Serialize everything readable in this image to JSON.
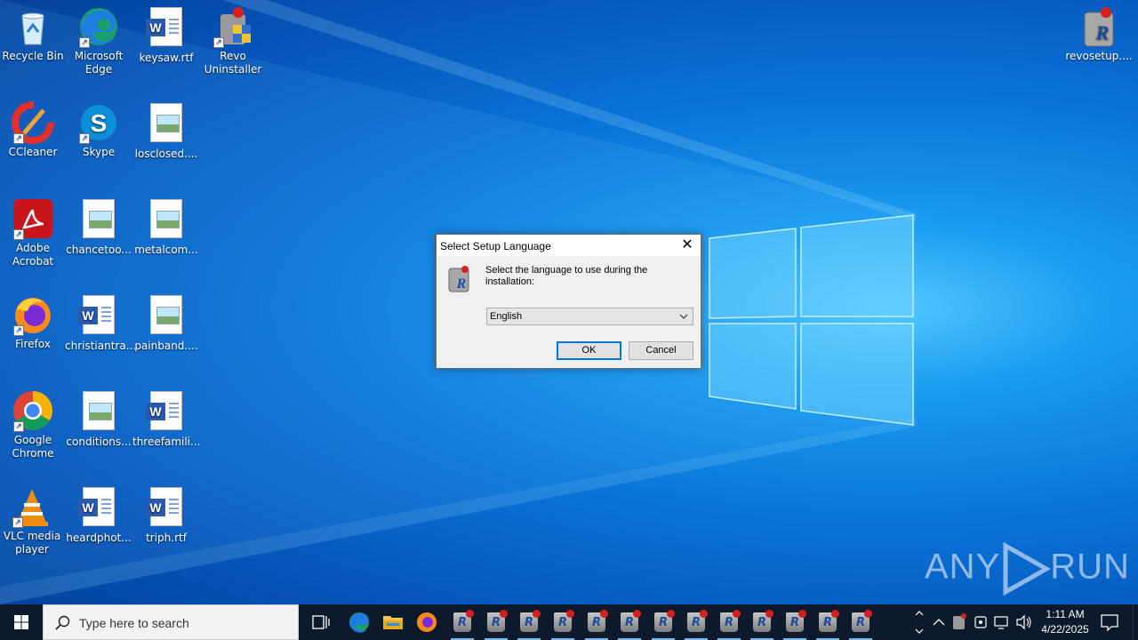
{
  "desktop": {
    "icons": [
      {
        "label": "Recycle Bin"
      },
      {
        "label": "Microsoft Edge"
      },
      {
        "label": "keysaw.rtf"
      },
      {
        "label": "Revo Uninstaller"
      },
      {
        "label": "CCleaner"
      },
      {
        "label": "Skype"
      },
      {
        "label": "losclosed...."
      },
      {
        "label": "Adobe Acrobat"
      },
      {
        "label": "chancetoo..."
      },
      {
        "label": "metalcom..."
      },
      {
        "label": "Firefox"
      },
      {
        "label": "christiantra..."
      },
      {
        "label": "painband...."
      },
      {
        "label": "Google Chrome"
      },
      {
        "label": "conditions..."
      },
      {
        "label": "threefamili..."
      },
      {
        "label": "VLC media player"
      },
      {
        "label": "heardphot..."
      },
      {
        "label": "triph.rtf"
      },
      {
        "label": "revosetup...."
      }
    ]
  },
  "dialog": {
    "title": "Select Setup Language",
    "message": "Select the language to use during the installation:",
    "selected_language": "English",
    "ok_label": "OK",
    "cancel_label": "Cancel"
  },
  "watermark": {
    "text_left": "ANY",
    "text_right": "RUN"
  },
  "taskbar": {
    "search_placeholder": "Type here to search",
    "running_revo_count": 13,
    "clock_time": "1:11 AM",
    "clock_date": "4/22/2025"
  },
  "colors": {
    "taskbar": "#0d1a2b",
    "accent": "#0078d7",
    "desktop": "#0a74d8"
  }
}
